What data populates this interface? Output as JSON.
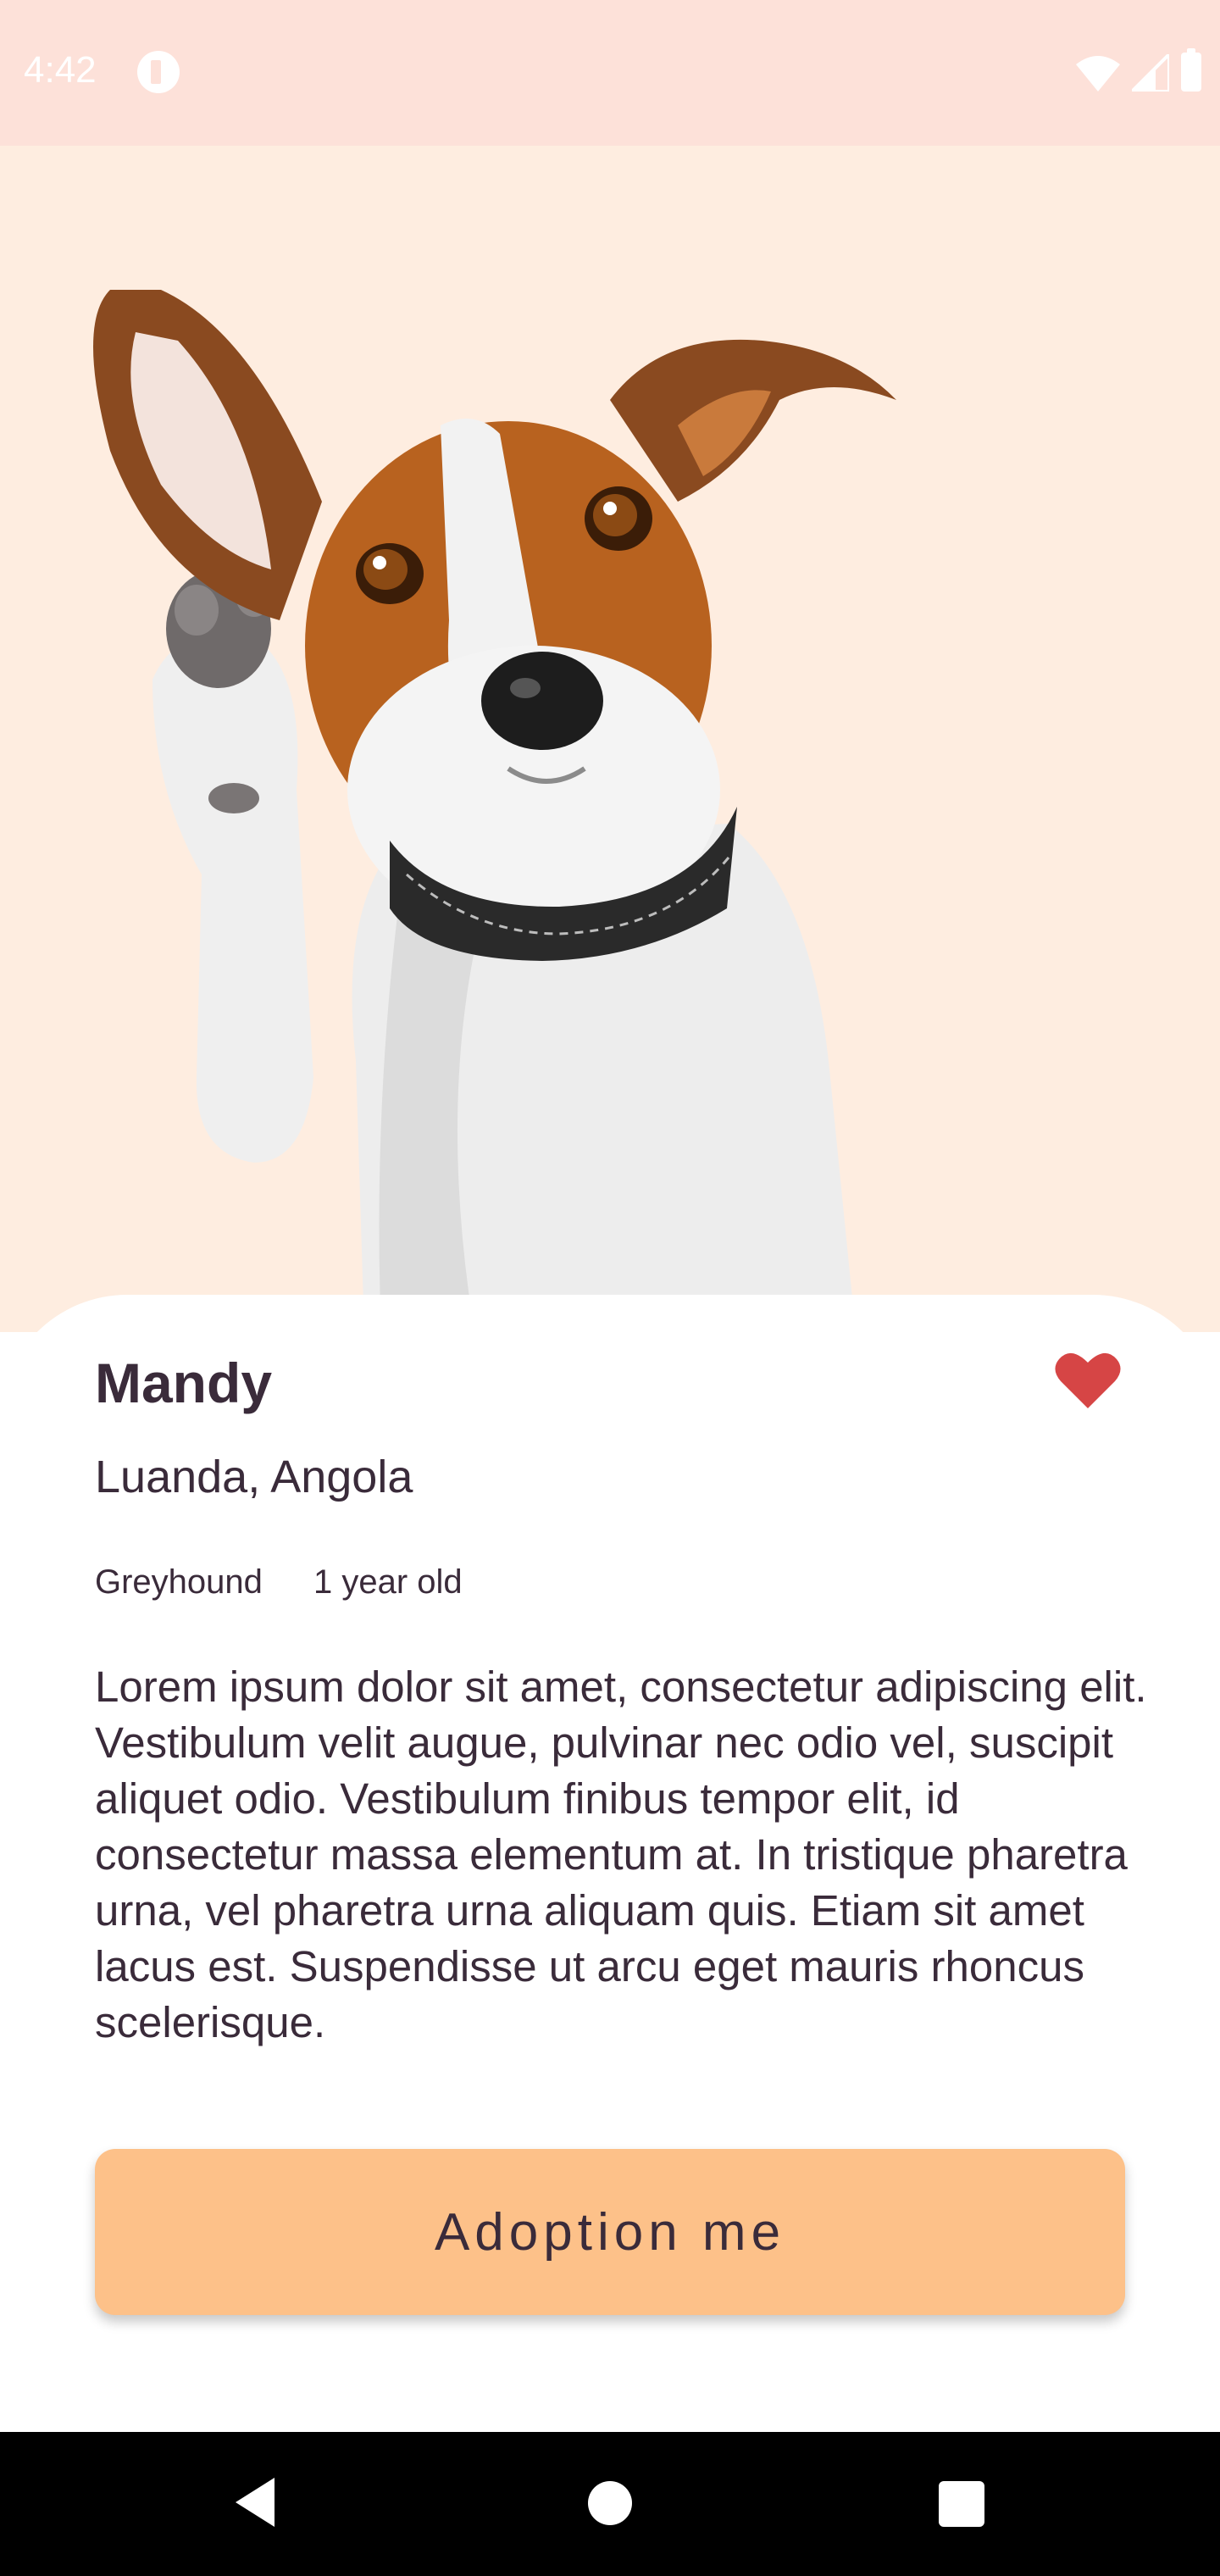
{
  "status_bar": {
    "time": "4:42",
    "background": "#fde1d9",
    "icons": [
      "app-notification-icon",
      "wifi-icon",
      "cell-signal-icon",
      "battery-icon"
    ]
  },
  "hero": {
    "background": "#feede0",
    "image": "jack-russell-terrier-dog-photo"
  },
  "pet": {
    "name": "Mandy",
    "location": "Luanda, Angola",
    "breed": "Greyhound",
    "age": "1 year old",
    "description": "Lorem ipsum dolor sit amet, consectetur adipiscing elit. Vestibulum velit augue, pulvinar nec odio vel, suscipit aliquet odio. Vestibulum finibus tempor elit, id consectetur massa elementum at. In tristique pharetra urna, vel pharetra urna aliquam quis. Etiam sit amet lacus est. Suspendisse ut arcu eget mauris rhoncus scelerisque.",
    "favorite": true,
    "favorite_icon": "heart-icon",
    "favorite_color": "#d64545"
  },
  "actions": {
    "adopt_label": "Adoption me",
    "adopt_color": "#fdc189"
  },
  "nav_bar": {
    "buttons": [
      "back-icon",
      "home-icon",
      "recents-icon"
    ]
  }
}
